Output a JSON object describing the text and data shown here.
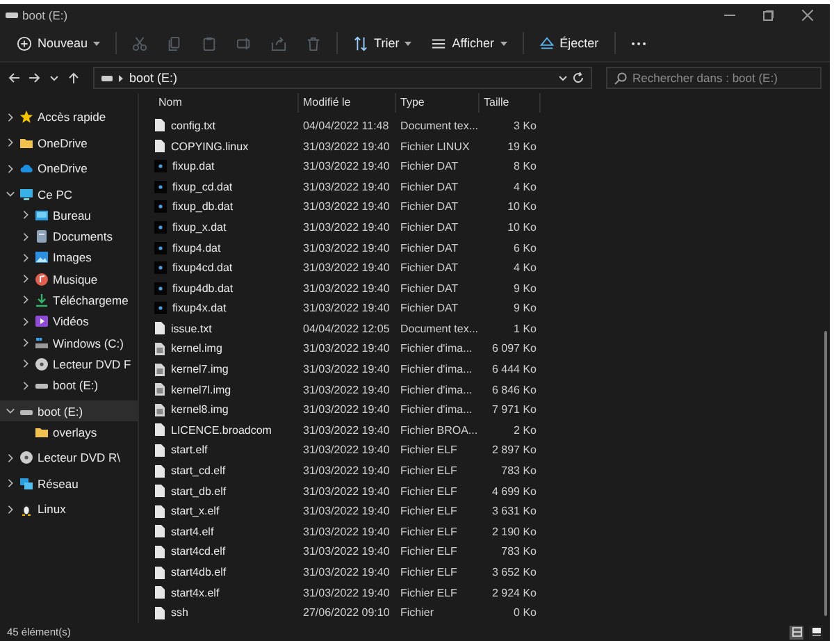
{
  "window": {
    "title": "boot (E:)"
  },
  "toolbar": [
    {
      "kind": "new",
      "label": "Nouveau",
      "disabled": false
    },
    {
      "kind": "cut",
      "disabled": true
    },
    {
      "kind": "copy",
      "disabled": true
    },
    {
      "kind": "paste",
      "disabled": true
    },
    {
      "kind": "rename",
      "disabled": true
    },
    {
      "kind": "share",
      "disabled": true
    },
    {
      "kind": "delete",
      "disabled": true
    },
    {
      "kind": "sort",
      "label": "Trier",
      "disabled": false
    },
    {
      "kind": "view",
      "label": "Afficher",
      "disabled": false
    },
    {
      "kind": "eject",
      "label": "Éjecter",
      "disabled": false
    },
    {
      "kind": "more"
    }
  ],
  "address": {
    "path": "boot (E:)"
  },
  "search": {
    "placeholder": "Rechercher dans : boot (E:)"
  },
  "sidebar": {
    "items": [
      {
        "kind": "star",
        "label": "Accès rapide",
        "expanded": false,
        "selected": false
      },
      {
        "kind": "folder",
        "label": "OneDrive",
        "expanded": false,
        "selected": false
      },
      {
        "kind": "cloud",
        "label": "OneDrive",
        "expanded": false,
        "selected": false
      },
      {
        "kind": "pc",
        "label": "Ce PC",
        "expanded": true,
        "selected": false,
        "children": [
          {
            "kind": "desktop",
            "label": "Bureau",
            "expanded": false,
            "selected": false
          },
          {
            "kind": "documents",
            "label": "Documents",
            "expanded": false,
            "selected": false
          },
          {
            "kind": "pictures",
            "label": "Images",
            "expanded": false,
            "selected": false
          },
          {
            "kind": "music",
            "label": "Musique",
            "expanded": false,
            "selected": false
          },
          {
            "kind": "download",
            "label": "Téléchargeme",
            "expanded": false,
            "selected": false
          },
          {
            "kind": "videos",
            "label": "Vidéos",
            "expanded": false,
            "selected": false
          },
          {
            "kind": "windrive",
            "label": "Windows (C:)",
            "expanded": false,
            "selected": false
          },
          {
            "kind": "disc",
            "label": "Lecteur DVD F",
            "expanded": false,
            "selected": false
          },
          {
            "kind": "drive",
            "label": "boot (E:)",
            "expanded": false,
            "selected": false
          }
        ]
      },
      {
        "kind": "drive",
        "label": "boot (E:)",
        "expanded": true,
        "selected": true,
        "children": [
          {
            "kind": "folder",
            "label": "overlays",
            "selected": false
          }
        ]
      },
      {
        "kind": "disc",
        "label": "Lecteur DVD R\\",
        "expanded": false,
        "selected": false
      },
      {
        "kind": "network",
        "label": "Réseau",
        "expanded": false,
        "selected": false
      },
      {
        "kind": "linux",
        "label": "Linux",
        "expanded": false,
        "selected": false
      }
    ]
  },
  "table": {
    "columns": [
      "Nom",
      "Modifié le",
      "Type",
      "Taille"
    ],
    "rows": [
      {
        "kind": "document",
        "name": "config.txt",
        "modified": "04/04/2022 11:48",
        "type": "Document tex...",
        "size": "3 Ko"
      },
      {
        "kind": "document",
        "name": "COPYING.linux",
        "modified": "31/03/2022 19:40",
        "type": "Fichier LINUX",
        "size": "19 Ko"
      },
      {
        "kind": "dat",
        "name": "fixup.dat",
        "modified": "31/03/2022 19:40",
        "type": "Fichier DAT",
        "size": "8 Ko"
      },
      {
        "kind": "dat",
        "name": "fixup_cd.dat",
        "modified": "31/03/2022 19:40",
        "type": "Fichier DAT",
        "size": "4 Ko"
      },
      {
        "kind": "dat",
        "name": "fixup_db.dat",
        "modified": "31/03/2022 19:40",
        "type": "Fichier DAT",
        "size": "10 Ko"
      },
      {
        "kind": "dat",
        "name": "fixup_x.dat",
        "modified": "31/03/2022 19:40",
        "type": "Fichier DAT",
        "size": "10 Ko"
      },
      {
        "kind": "dat",
        "name": "fixup4.dat",
        "modified": "31/03/2022 19:40",
        "type": "Fichier DAT",
        "size": "6 Ko"
      },
      {
        "kind": "dat",
        "name": "fixup4cd.dat",
        "modified": "31/03/2022 19:40",
        "type": "Fichier DAT",
        "size": "4 Ko"
      },
      {
        "kind": "dat",
        "name": "fixup4db.dat",
        "modified": "31/03/2022 19:40",
        "type": "Fichier DAT",
        "size": "9 Ko"
      },
      {
        "kind": "dat",
        "name": "fixup4x.dat",
        "modified": "31/03/2022 19:40",
        "type": "Fichier DAT",
        "size": "9 Ko"
      },
      {
        "kind": "document",
        "name": "issue.txt",
        "modified": "04/04/2022 12:05",
        "type": "Document tex...",
        "size": "1 Ko"
      },
      {
        "kind": "image",
        "name": "kernel.img",
        "modified": "31/03/2022 19:40",
        "type": "Fichier d'ima...",
        "size": "6 097 Ko"
      },
      {
        "kind": "image",
        "name": "kernel7.img",
        "modified": "31/03/2022 19:40",
        "type": "Fichier d'ima...",
        "size": "6 444 Ko"
      },
      {
        "kind": "image",
        "name": "kernel7l.img",
        "modified": "31/03/2022 19:40",
        "type": "Fichier d'ima...",
        "size": "6 846 Ko"
      },
      {
        "kind": "image",
        "name": "kernel8.img",
        "modified": "31/03/2022 19:40",
        "type": "Fichier d'ima...",
        "size": "7 971 Ko"
      },
      {
        "kind": "document",
        "name": "LICENCE.broadcom",
        "modified": "31/03/2022 19:40",
        "type": "Fichier BROA...",
        "size": "2 Ko"
      },
      {
        "kind": "document",
        "name": "start.elf",
        "modified": "31/03/2022 19:40",
        "type": "Fichier ELF",
        "size": "2 897 Ko"
      },
      {
        "kind": "document",
        "name": "start_cd.elf",
        "modified": "31/03/2022 19:40",
        "type": "Fichier ELF",
        "size": "783 Ko"
      },
      {
        "kind": "document",
        "name": "start_db.elf",
        "modified": "31/03/2022 19:40",
        "type": "Fichier ELF",
        "size": "4 699 Ko"
      },
      {
        "kind": "document",
        "name": "start_x.elf",
        "modified": "31/03/2022 19:40",
        "type": "Fichier ELF",
        "size": "3 631 Ko"
      },
      {
        "kind": "document",
        "name": "start4.elf",
        "modified": "31/03/2022 19:40",
        "type": "Fichier ELF",
        "size": "2 190 Ko"
      },
      {
        "kind": "document",
        "name": "start4cd.elf",
        "modified": "31/03/2022 19:40",
        "type": "Fichier ELF",
        "size": "783 Ko"
      },
      {
        "kind": "document",
        "name": "start4db.elf",
        "modified": "31/03/2022 19:40",
        "type": "Fichier ELF",
        "size": "3 652 Ko"
      },
      {
        "kind": "document",
        "name": "start4x.elf",
        "modified": "31/03/2022 19:40",
        "type": "Fichier ELF",
        "size": "2 924 Ko"
      },
      {
        "kind": "document",
        "name": "ssh",
        "modified": "27/06/2022 09:10",
        "type": "Fichier",
        "size": "0 Ko"
      }
    ]
  },
  "status_bar": {
    "count": "45 élément(s)",
    "views": [
      {
        "kind": "details",
        "selected": true
      },
      {
        "kind": "tiles",
        "selected": false
      }
    ]
  }
}
